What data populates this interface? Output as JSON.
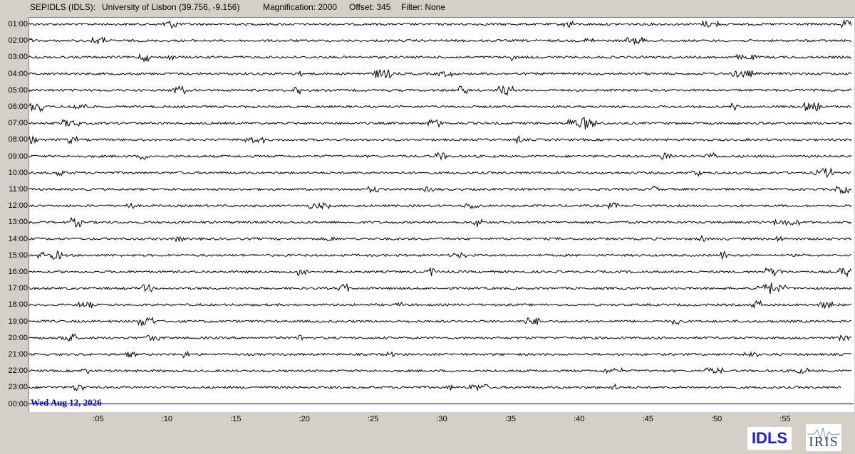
{
  "header": {
    "station": "SEPIDLS (IDLS):",
    "location": "University of Lisbon (39.756, -9.156)",
    "magnification": "Magnification: 2000",
    "offset": "Offset: 345",
    "filter": "Filter: None"
  },
  "hour_labels": [
    "01:00",
    "02:00",
    "03:00",
    "04:00",
    "05:00",
    "06:00",
    "07:00",
    "08:00",
    "09:00",
    "10:00",
    "11:00",
    "12:00",
    "13:00",
    "14:00",
    "15:00",
    "16:00",
    "17:00",
    "18:00",
    "19:00",
    "20:00",
    "21:00",
    "22:00",
    "23:00",
    "00:00"
  ],
  "minute_ticks": [
    ":05",
    ":10",
    ":15",
    ":20",
    ":25",
    ":30",
    ":35",
    ":40",
    ":45",
    ":50",
    ":55"
  ],
  "date_label": "Wed Aug 12, 2026",
  "logos": {
    "idls": "IDLS",
    "iris": "IRIS"
  },
  "colors": {
    "trace": "#000000",
    "date_line": "#0000cc",
    "date_text": "#0000cc",
    "idls_logo": "#1e1ecc"
  }
}
